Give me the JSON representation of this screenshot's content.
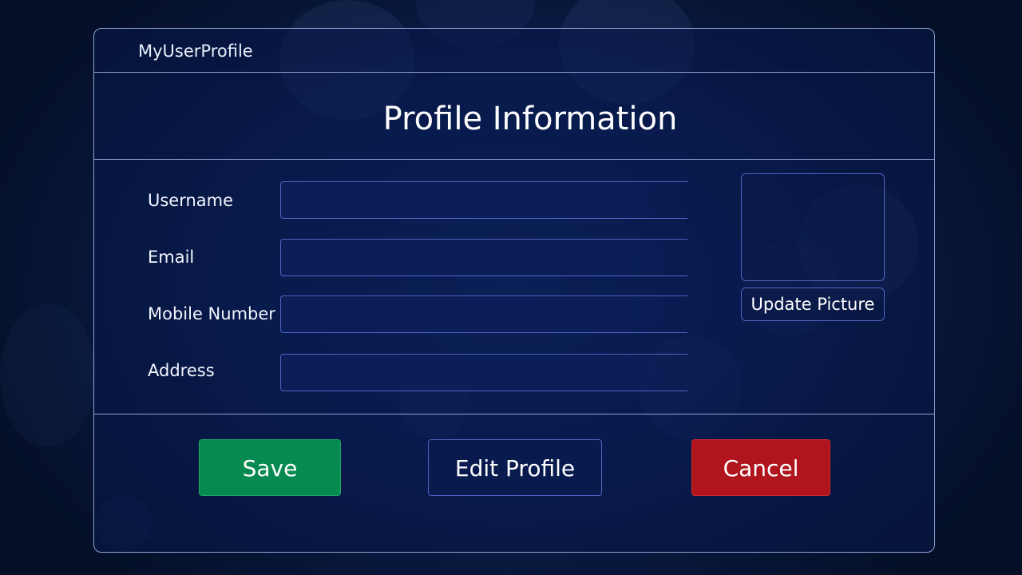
{
  "app": {
    "title": "MyUserProfile"
  },
  "header": {
    "title": "Profile Information"
  },
  "form": {
    "fields": [
      {
        "label": "Username",
        "value": "",
        "placeholder": ""
      },
      {
        "label": "Email",
        "value": "",
        "placeholder": ""
      },
      {
        "label": "Mobile Number",
        "value": "",
        "placeholder": ""
      },
      {
        "label": "Address",
        "value": "",
        "placeholder": ""
      }
    ]
  },
  "picture": {
    "update_label": "Update Picture"
  },
  "actions": {
    "save_label": "Save",
    "edit_label": "Edit Profile",
    "cancel_label": "Cancel"
  },
  "colors": {
    "background": "#0a1f52",
    "border": "#8fa3d6",
    "input_border": "#4e63c2",
    "save": "#068a50",
    "cancel": "#b0151d"
  }
}
